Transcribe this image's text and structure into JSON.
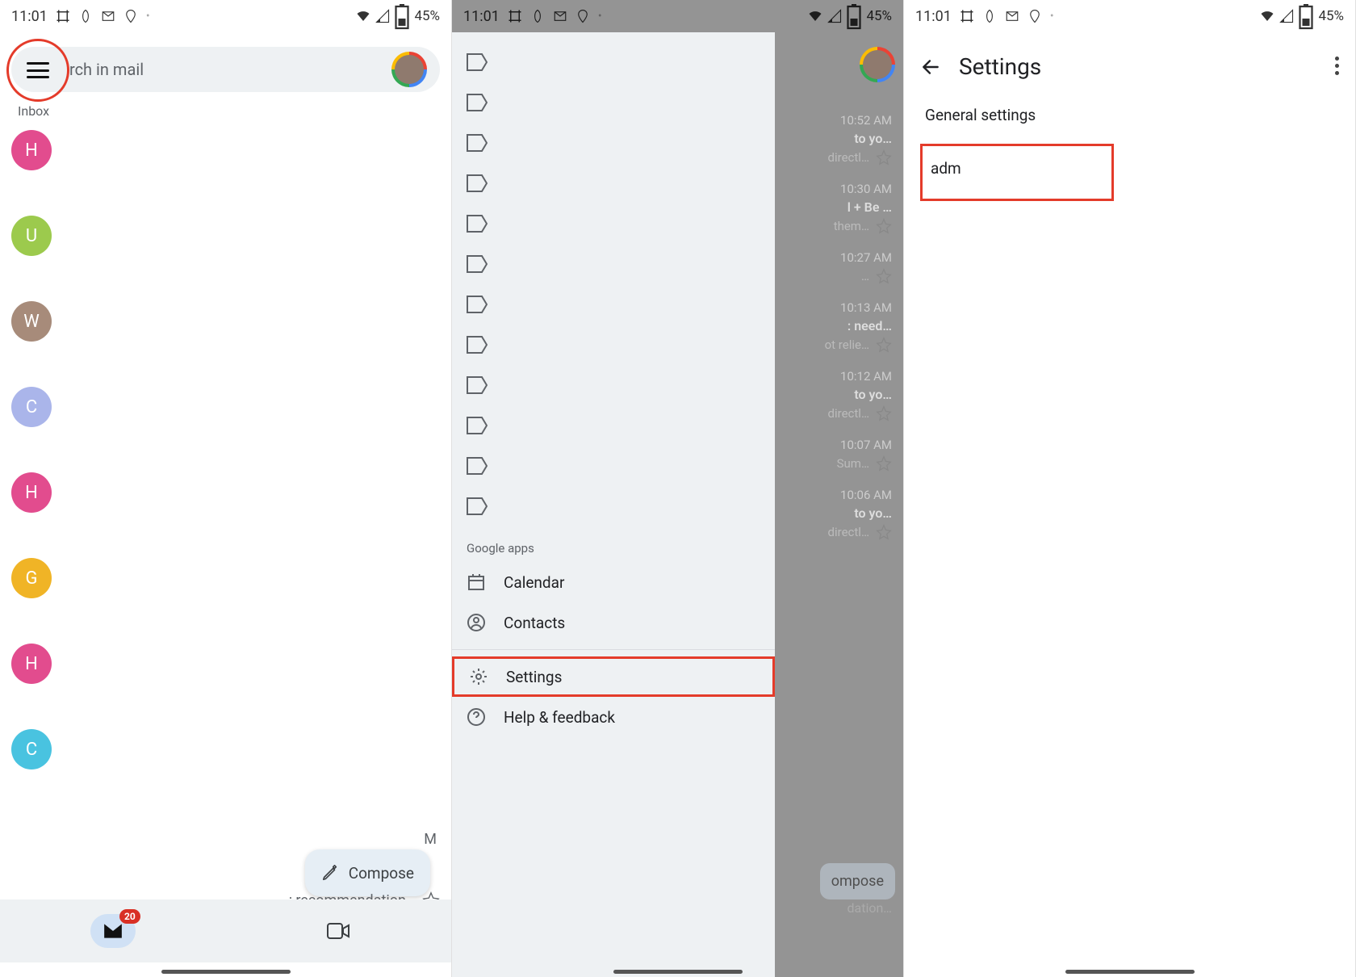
{
  "status": {
    "time": "11:01",
    "battery": "45%"
  },
  "panel1": {
    "search_placeholder": "rch in mail",
    "inbox_label": "Inbox",
    "avatars": [
      {
        "letter": "H",
        "color": "#e24c8e"
      },
      {
        "letter": "U",
        "color": "#9cca4d"
      },
      {
        "letter": "W",
        "color": "#a78b7a"
      },
      {
        "letter": "C",
        "color": "#aab5ea"
      },
      {
        "letter": "H",
        "color": "#e24c8e"
      },
      {
        "letter": "G",
        "color": "#f0b426"
      },
      {
        "letter": "H",
        "color": "#e24c8e"
      },
      {
        "letter": "C",
        "color": "#49c3e0"
      }
    ],
    "compose": "Compose",
    "snippet_ellipsis": "M",
    "snippet_last": "; recommendation…",
    "badge_count": "20"
  },
  "panel2": {
    "drawer": {
      "google_apps": "Google apps",
      "calendar": "Calendar",
      "contacts": "Contacts",
      "settings": "Settings",
      "help": "Help & feedback"
    },
    "sliver": {
      "rows": [
        {
          "time": "10:52 AM",
          "line1": "to yo…",
          "line2": "directl…"
        },
        {
          "time": "10:30 AM",
          "line1": "l + Be …",
          "line2": "them…"
        },
        {
          "time": "10:27 AM",
          "line1": "…",
          "line2": ""
        },
        {
          "time": "10:13 AM",
          "line1": ": need…",
          "line2": "ot relie…"
        },
        {
          "time": "10:12 AM",
          "line1": "to yo…",
          "line2": "directl…"
        },
        {
          "time": "10:07 AM",
          "line1": "",
          "line2": "Sum…"
        },
        {
          "time": "10:06 AM",
          "line1": "to yo…",
          "line2": "directl…"
        }
      ],
      "compose": "ompose",
      "bottom_text": "dation…"
    }
  },
  "panel3": {
    "title": "Settings",
    "general": "General settings",
    "account": "adm"
  }
}
